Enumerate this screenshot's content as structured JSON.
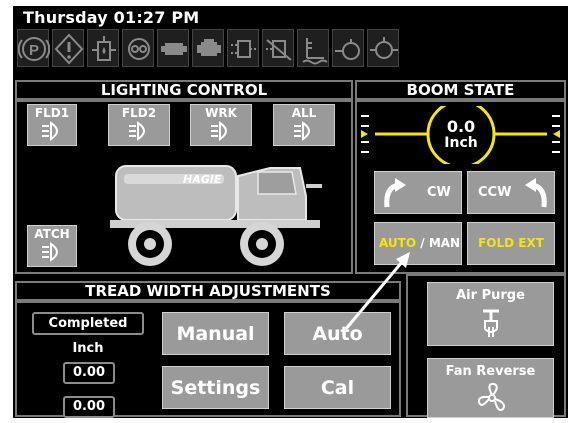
{
  "status_bar": {
    "datetime": "Thursday 01:27 PM"
  },
  "indicators": [
    {
      "icon": "parking-brake-icon"
    },
    {
      "icon": "warning-icon"
    },
    {
      "icon": "fuel-filter-icon"
    },
    {
      "icon": "engine-icon"
    },
    {
      "icon": "battery-icon"
    },
    {
      "icon": "engine-block-icon"
    },
    {
      "icon": "transmission-icon"
    },
    {
      "icon": "hydraulic-filter-icon"
    },
    {
      "icon": "hydraulic-level-icon"
    },
    {
      "icon": "oil-pressure-icon"
    },
    {
      "icon": "coolant-icon"
    }
  ],
  "lighting_control": {
    "title": "LIGHTING CONTROL",
    "buttons": [
      "FLD1",
      "FLD2",
      "WRK",
      "ALL"
    ],
    "attach_label": "ATCH",
    "machine_brand": "HAGIE"
  },
  "boom_state": {
    "title": "BOOM STATE",
    "gauge_value": "0.0",
    "gauge_unit": "Inch",
    "cw_label": "CW",
    "ccw_label": "CCW",
    "auto_label": "AUTO",
    "separator": "/",
    "man_label": "MAN",
    "fold_ext_label": "FOLD EXT",
    "accent_color": "#f5e50a"
  },
  "tread_width": {
    "title": "TREAD WIDTH ADJUSTMENTS",
    "status": "Completed",
    "unit": "Inch",
    "value1": "0.00",
    "value2": "0.00",
    "manual_label": "Manual",
    "auto_label": "Auto",
    "settings_label": "Settings",
    "cal_label": "Cal"
  },
  "right_controls": {
    "air_purge_label": "Air Purge",
    "fan_reverse_label": "Fan Reverse"
  }
}
